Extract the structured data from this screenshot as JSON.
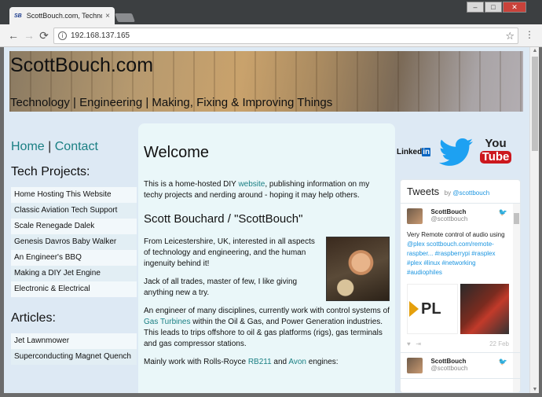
{
  "browser": {
    "tab_favicon": "SB",
    "tab_title": "ScottBouch.com, Technology",
    "tab_close": "×",
    "url": "192.168.137.165",
    "back_icon": "←",
    "forward_icon": "→",
    "reload_icon": "⟳",
    "star_icon": "☆",
    "menu_icon": "⋮",
    "minimize": "–",
    "maximize": "□",
    "close": "✕"
  },
  "header": {
    "title": "ScottBouch.com",
    "tagline": "Technology | Engineering | Making, Fixing & Improving Things"
  },
  "nav": {
    "home": "Home",
    "separator": "|",
    "contact": "Contact"
  },
  "tech_projects": {
    "heading": "Tech Projects:",
    "items": [
      "Home Hosting This Website",
      "Classic Aviation Tech Support",
      "Scale Renegade Dalek",
      "Genesis Davros Baby Walker",
      "An Engineer's BBQ",
      "Making a DIY Jet Engine",
      "Electronic & Electrical"
    ]
  },
  "articles": {
    "heading": "Articles:",
    "items": [
      "Jet Lawnmower",
      "Superconducting Magnet Quench"
    ]
  },
  "main": {
    "heading": "Welcome",
    "intro_before": "This is a home-hosted DIY ",
    "intro_link": "website",
    "intro_after": ", publishing information on my techy projects and nerding around - hoping it may help others.",
    "subheading": "Scott Bouchard / \"ScottBouch\"",
    "p1": "From Leicestershire, UK, interested in all aspects of technology and engineering, and the human ingenuity behind it!",
    "p2": "Jack of all trades, master of few, I like giving anything new a try.",
    "p3_before": "An engineer of many disciplines, currently work with control systems of ",
    "p3_link": "Gas Turbines",
    "p3_after": " within the Oil & Gas, and Power Generation industries. This leads to trips offshore to oil & gas platforms (rigs), gas terminals and gas compressor stations.",
    "p4_before": "Mainly work with Rolls-Royce ",
    "p4_link1": "RB211",
    "p4_mid": " and ",
    "p4_link2": "Avon",
    "p4_after": " engines:"
  },
  "social": {
    "linkedin_text": "Linked",
    "linkedin_in": "in",
    "youtube_you": "You",
    "youtube_tube": "Tube"
  },
  "tweets": {
    "title": "Tweets",
    "by": "by",
    "handle": "@scottbouch",
    "items": [
      {
        "name": "ScottBouch",
        "handle": "@scottbouch",
        "text": "Very Remote control of audio using",
        "links": "@plex scottbouch.com/remote-raspber... #raspberrypi #rasplex #plex #linux #networking #audiophiles",
        "media_text": "PL",
        "date": "22 Feb",
        "like_icon": "♥",
        "share_icon": "⇥"
      },
      {
        "name": "ScottBouch",
        "handle": "@scottbouch"
      }
    ],
    "bird_icon": "🐦"
  },
  "colors": {
    "link": "#1a7f83",
    "page_bg": "#dde9f4",
    "main_bg": "#eaf7f9",
    "twitter_blue": "#1da1f2",
    "youtube_red": "#cc181e"
  }
}
